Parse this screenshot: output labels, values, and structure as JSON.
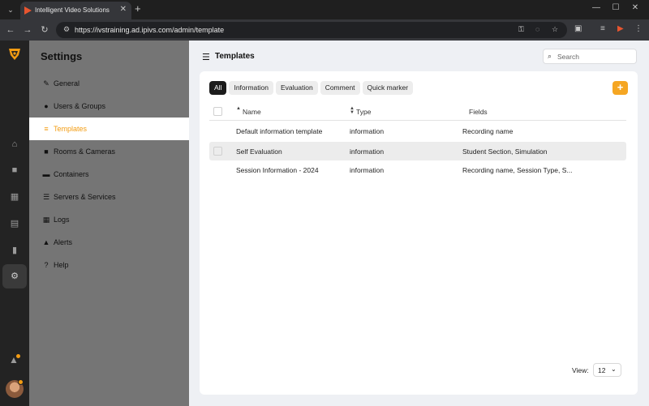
{
  "browser": {
    "tab_title": "Intelligent Video Solutions",
    "url": "https://ivstraining.ad.ipivs.com/admin/template"
  },
  "colors": {
    "accent": "#f39c12",
    "add_button": "#f5a623",
    "settings_panel": "#757575",
    "rail": "#232323"
  },
  "rail": {
    "items": [
      {
        "icon": "home-icon"
      },
      {
        "icon": "video-camera-icon"
      },
      {
        "icon": "film-icon"
      },
      {
        "icon": "calendar-icon"
      },
      {
        "icon": "bar-chart-icon"
      },
      {
        "icon": "gear-icon",
        "active": true
      }
    ]
  },
  "settings": {
    "title": "Settings",
    "nav": [
      {
        "label": "General",
        "icon": "wrench-icon"
      },
      {
        "label": "Users & Groups",
        "icon": "users-icon"
      },
      {
        "label": "Templates",
        "icon": "list-icon",
        "active": true
      },
      {
        "label": "Rooms & Cameras",
        "icon": "camera-icon"
      },
      {
        "label": "Containers",
        "icon": "archive-icon"
      },
      {
        "label": "Servers & Services",
        "icon": "server-icon"
      },
      {
        "label": "Logs",
        "icon": "calendar-icon"
      },
      {
        "label": "Alerts",
        "icon": "warning-icon"
      },
      {
        "label": "Help",
        "icon": "question-icon"
      }
    ]
  },
  "main": {
    "title": "Templates",
    "search_placeholder": "Search",
    "filters": [
      "All",
      "Information",
      "Evaluation",
      "Comment",
      "Quick marker"
    ],
    "active_filter": "All",
    "add_label": "+",
    "columns": [
      "Name",
      "Type",
      "Fields"
    ],
    "rows": [
      {
        "name": "Default information template",
        "type": "information",
        "fields": "Recording name"
      },
      {
        "name": "Self Evaluation",
        "type": "information",
        "fields": "Student Section, Simulation"
      },
      {
        "name": "Session Information - 2024",
        "type": "information",
        "fields": "Recording name, Session Type, S..."
      }
    ],
    "view_label": "View:",
    "view_value": "12"
  }
}
